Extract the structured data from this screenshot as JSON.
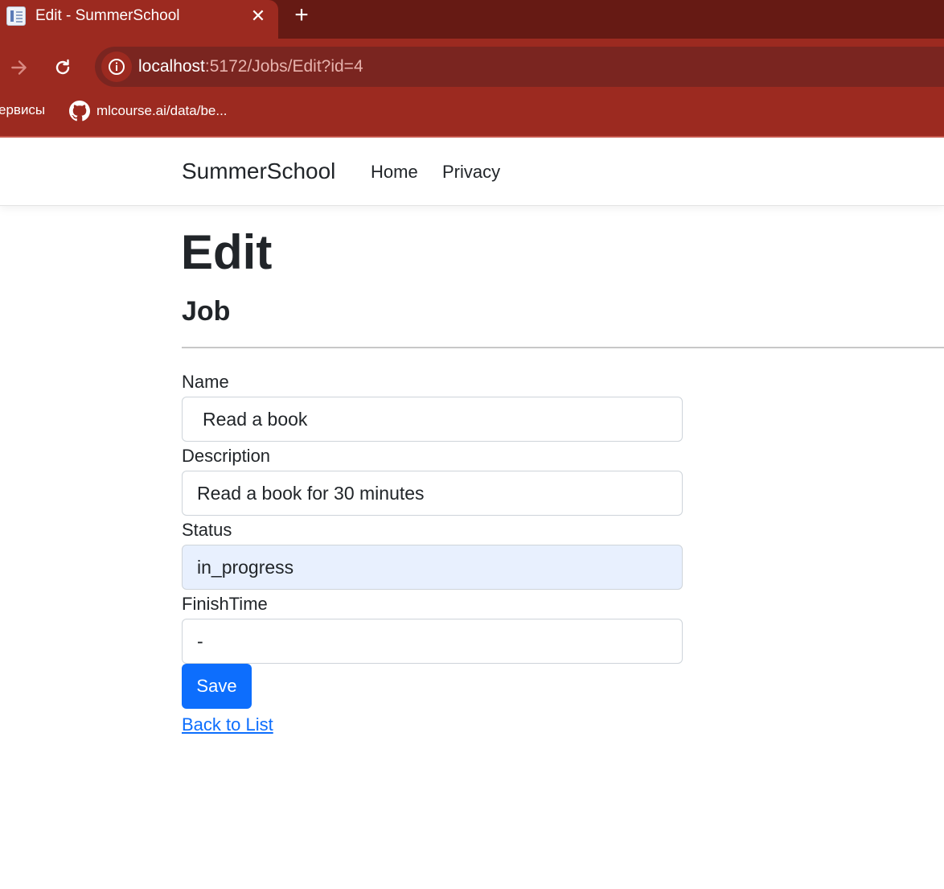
{
  "browser": {
    "tab_title": "Edit - SummerSchool",
    "tab_close": "✕",
    "new_tab": "+",
    "url_host": "localhost",
    "url_path": ":5172/Jobs/Edit?id=4",
    "bookmarks": [
      {
        "label": "ервисы",
        "icon": "none"
      },
      {
        "label": "mlcourse.ai/data/be...",
        "icon": "github-icon"
      }
    ],
    "colors": {
      "frame": "#9c2a20",
      "tabstrip": "#661a14",
      "omnibox": "#7a2520"
    }
  },
  "navbar": {
    "brand": "SummerSchool",
    "links": [
      "Home",
      "Privacy"
    ]
  },
  "page": {
    "title": "Edit",
    "subtitle": "Job"
  },
  "form": {
    "fields": [
      {
        "label": "Name",
        "value": "Read a book"
      },
      {
        "label": "Description",
        "value": "Read a book for 30 minutes"
      },
      {
        "label": "Status",
        "value": "in_progress"
      },
      {
        "label": "FinishTime",
        "value": "-"
      }
    ],
    "save_label": "Save",
    "back_label": "Back to List"
  },
  "colors": {
    "primary": "#0d6efd",
    "autofill": "#e8f0fe",
    "text": "#212529"
  }
}
